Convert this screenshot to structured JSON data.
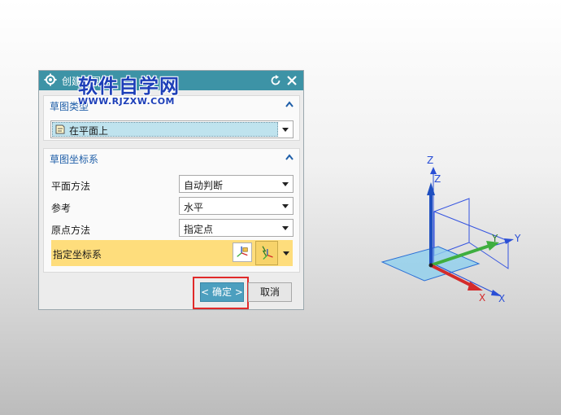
{
  "dialog": {
    "title": "创建草图",
    "reset_icon": "reset-icon",
    "close_icon": "close-icon"
  },
  "watermark": {
    "main": "软件自学网",
    "url": "WWW.RJZXW.COM"
  },
  "section_type": {
    "label": "草图类型",
    "dropdown_value": "在平面上"
  },
  "section_csys": {
    "label": "草图坐标系",
    "plane_method_label": "平面方法",
    "plane_method_value": "自动判断",
    "reference_label": "参考",
    "reference_value": "水平",
    "origin_method_label": "原点方法",
    "origin_method_value": "指定点",
    "specify_csys_label": "指定坐标系"
  },
  "buttons": {
    "ok": "< 确定 >",
    "cancel": "取消"
  },
  "colors": {
    "titlebar": "#3d93a6",
    "section_header": "#1e5ea8",
    "highlight_row": "#fedd7c",
    "ok_button": "#4c9fbf",
    "ok_outline": "#e02a2a",
    "axis_x": "#d42b2b",
    "axis_y": "#3fae3f",
    "axis_z": "#1f4fc0",
    "plane": "#8fd0ee"
  },
  "viewport": {
    "labels": {
      "z1": "Z",
      "z2": "Z",
      "y1": "Y",
      "y2": "Y",
      "x1": "X",
      "x2": "X"
    }
  }
}
